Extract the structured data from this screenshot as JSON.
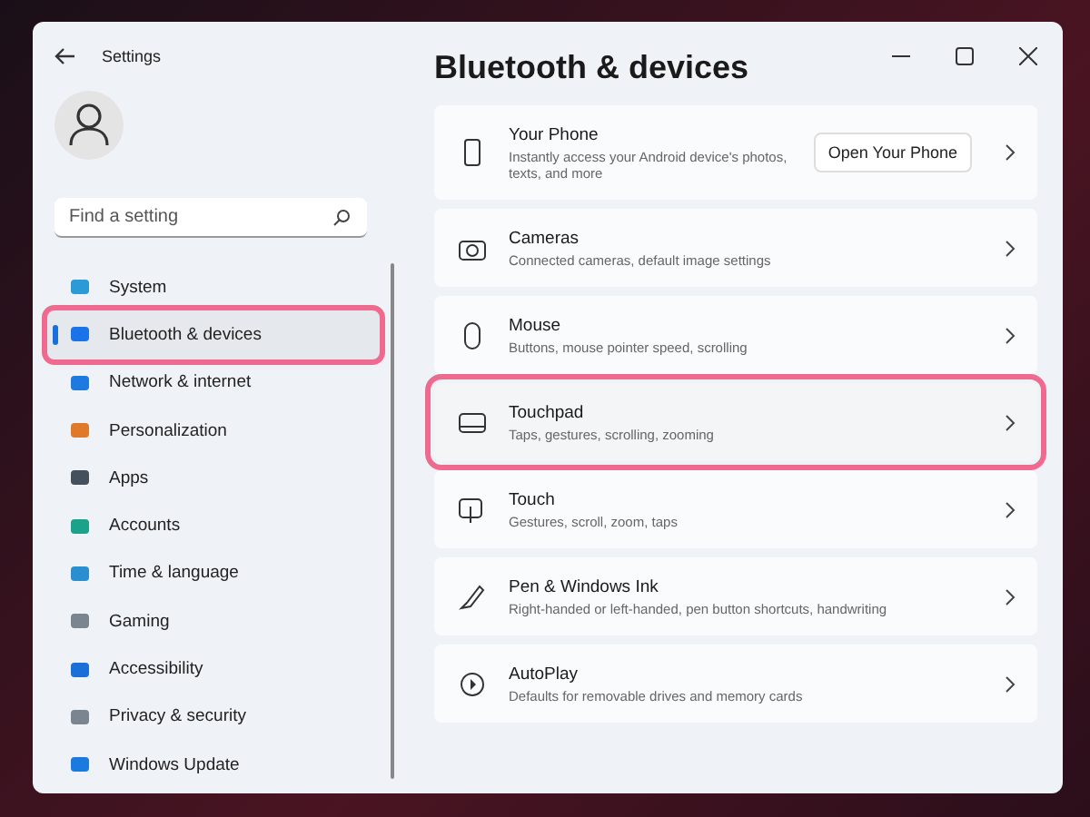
{
  "window": {
    "title": "Settings"
  },
  "search": {
    "placeholder": "Find a setting"
  },
  "nav": [
    {
      "label": "System",
      "selected": false,
      "highlighted": false
    },
    {
      "label": "Bluetooth & devices",
      "selected": true,
      "highlighted": true
    },
    {
      "label": "Network & internet",
      "selected": false,
      "highlighted": false
    },
    {
      "label": "Personalization",
      "selected": false,
      "highlighted": false
    },
    {
      "label": "Apps",
      "selected": false,
      "highlighted": false
    },
    {
      "label": "Accounts",
      "selected": false,
      "highlighted": false
    },
    {
      "label": "Time & language",
      "selected": false,
      "highlighted": false
    },
    {
      "label": "Gaming",
      "selected": false,
      "highlighted": false
    },
    {
      "label": "Accessibility",
      "selected": false,
      "highlighted": false
    },
    {
      "label": "Privacy & security",
      "selected": false,
      "highlighted": false
    },
    {
      "label": "Windows Update",
      "selected": false,
      "highlighted": false
    }
  ],
  "page_title": "Bluetooth & devices",
  "cards": [
    {
      "title": "Your Phone",
      "description": "Instantly access your Android device's photos, texts, and more",
      "button": "Open Your Phone",
      "highlighted": false
    },
    {
      "title": "Cameras",
      "description": "Connected cameras, default image settings",
      "highlighted": false
    },
    {
      "title": "Mouse",
      "description": "Buttons, mouse pointer speed, scrolling",
      "highlighted": false
    },
    {
      "title": "Touchpad",
      "description": "Taps, gestures, scrolling, zooming",
      "highlighted": true
    },
    {
      "title": "Touch",
      "description": "Gestures, scroll, zoom, taps",
      "highlighted": false
    },
    {
      "title": "Pen & Windows Ink",
      "description": "Right-handed or left-handed, pen button shortcuts, handwriting",
      "highlighted": false
    },
    {
      "title": "AutoPlay",
      "description": "Defaults for removable drives and memory cards",
      "highlighted": false
    }
  ]
}
